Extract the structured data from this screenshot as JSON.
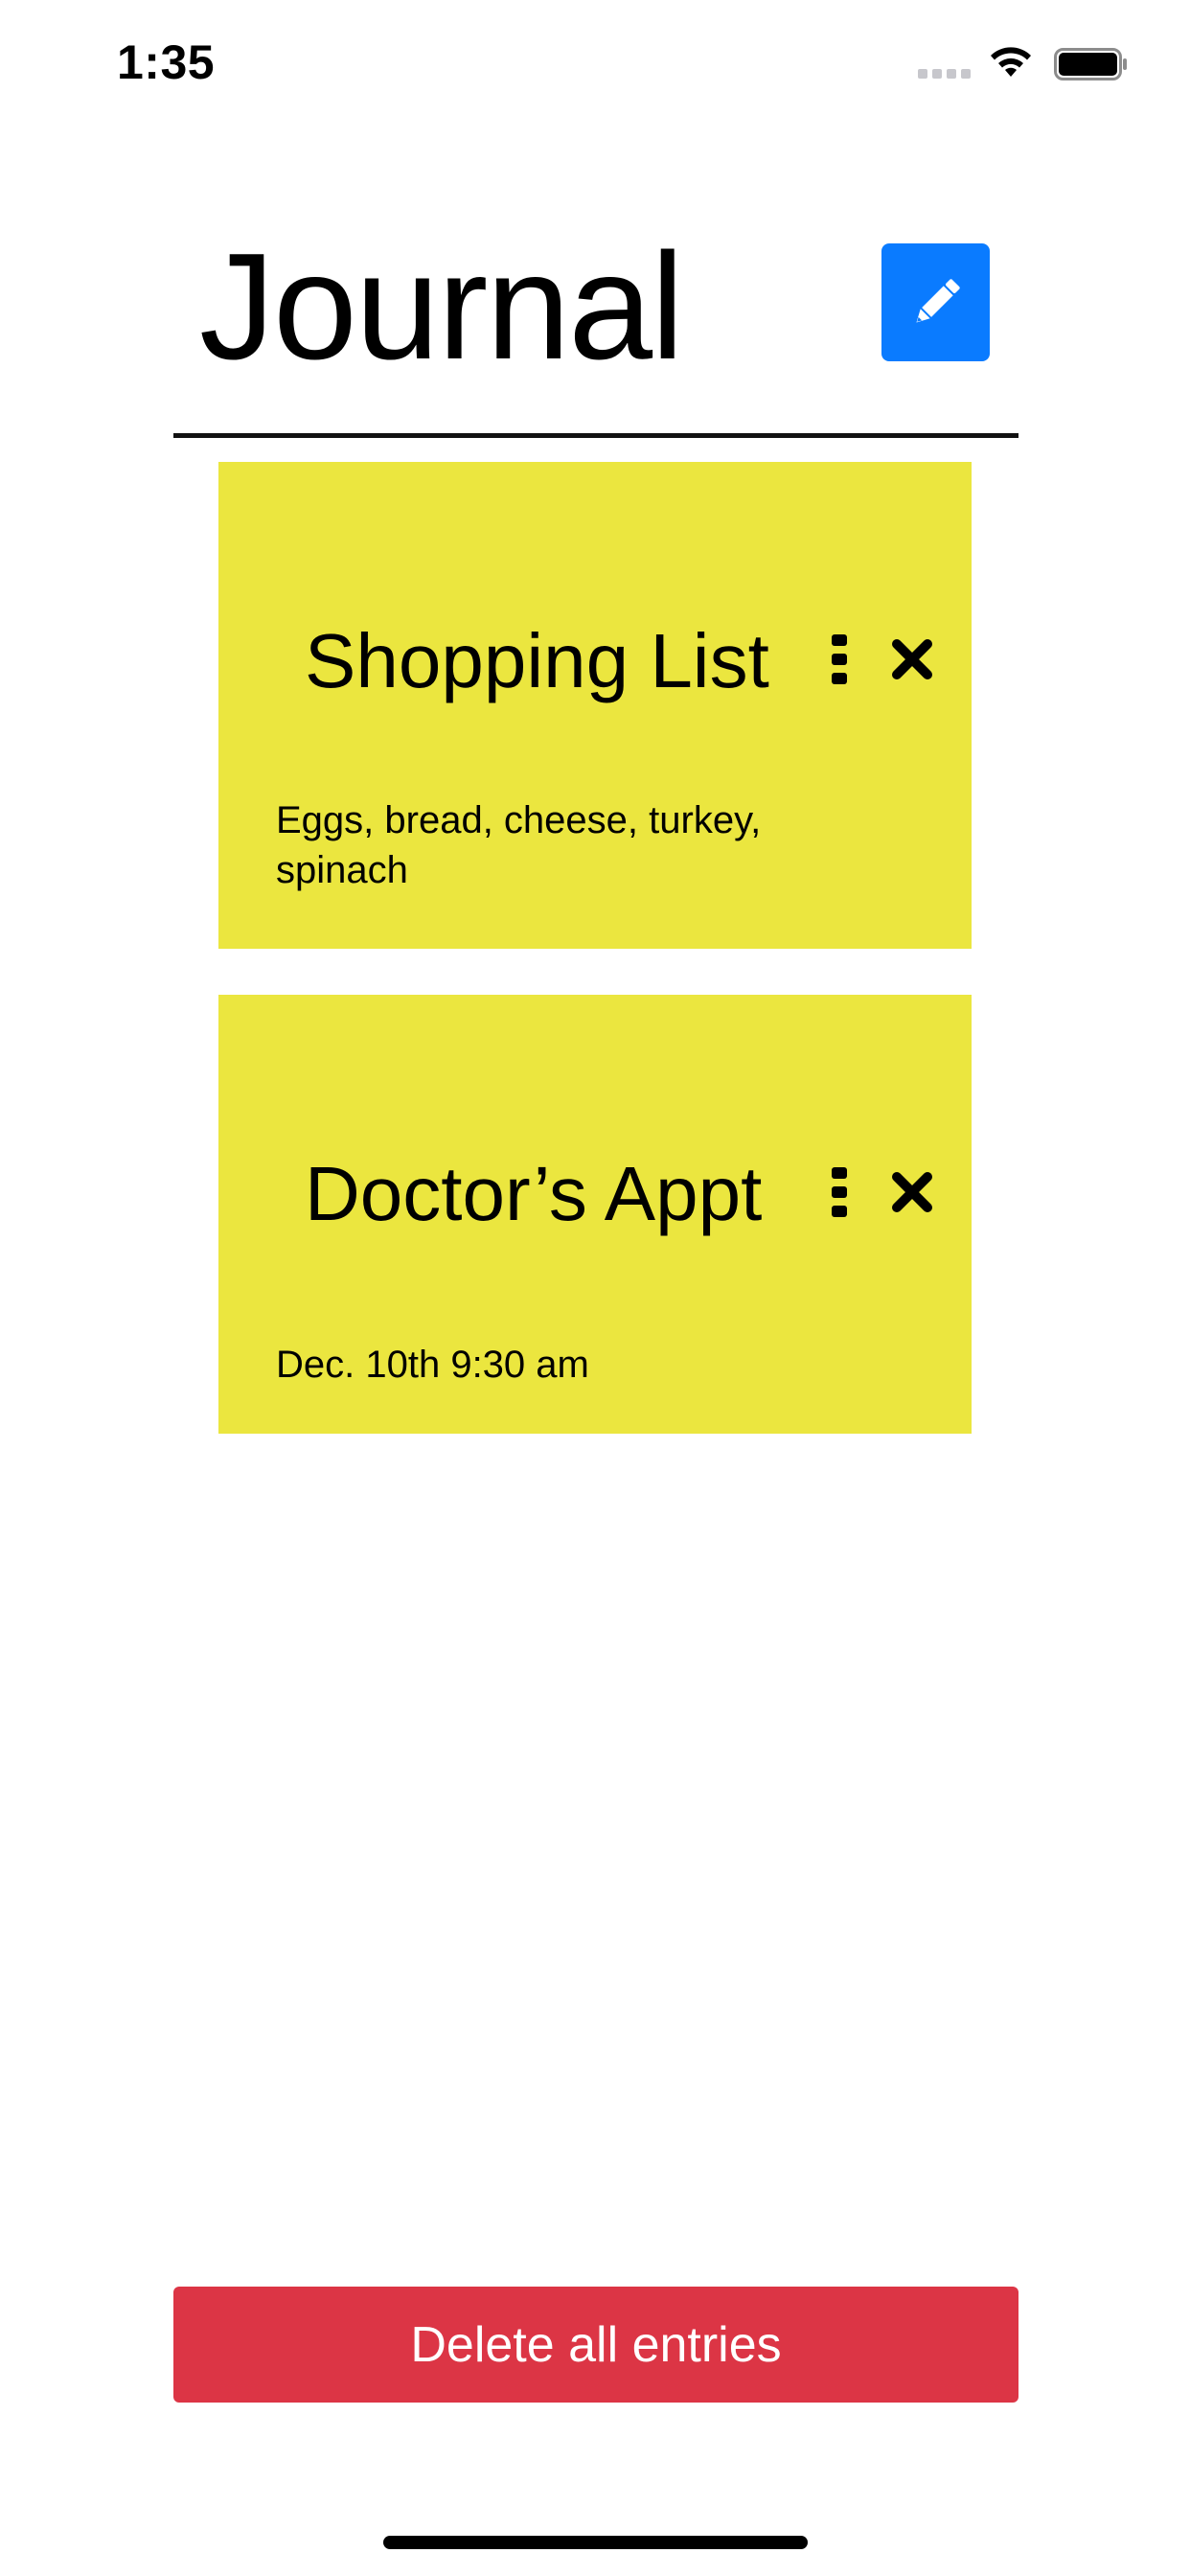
{
  "status_bar": {
    "time": "1:35"
  },
  "header": {
    "title": "Journal",
    "compose_icon": "pencil-icon",
    "accent_color": "#0a7bff"
  },
  "entries": [
    {
      "title": "Shopping List",
      "body": "Eggs, bread, cheese, turkey, spinach",
      "more_icon": "more-vertical-icon",
      "close_icon": "close-icon"
    },
    {
      "title": "Doctor’s Appt",
      "body": "Dec. 10th 9:30 am",
      "more_icon": "more-vertical-icon",
      "close_icon": "close-icon"
    }
  ],
  "card_color": "#ebe63f",
  "footer": {
    "delete_label": "Delete all entries",
    "delete_color": "#dc3545"
  }
}
